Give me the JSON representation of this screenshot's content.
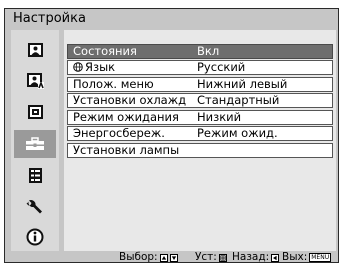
{
  "window": {
    "title": "Настройка"
  },
  "sidebar": {
    "items": [
      {
        "icon": "picture-icon"
      },
      {
        "icon": "picture-settings-icon"
      },
      {
        "icon": "screen-icon"
      },
      {
        "icon": "settings-toolbox-icon",
        "selected": true
      },
      {
        "icon": "menu-list-icon"
      },
      {
        "icon": "wrench-icon"
      },
      {
        "icon": "info-icon"
      }
    ]
  },
  "menu": {
    "rows": [
      {
        "label": "Состояния",
        "value": "Вкл",
        "selected": true
      },
      {
        "label": "Язык",
        "value": "Русский",
        "icon": "globe-icon"
      },
      {
        "label": "Полож. меню",
        "value": "Нижний левый"
      },
      {
        "label": "Установки охлажд",
        "value": "Стандартный"
      },
      {
        "label": "Режим ожидания",
        "value": "Низкий"
      },
      {
        "label": "Энергосбереж.",
        "value": "Режим ожид."
      },
      {
        "label": "Установки лампы",
        "value": ""
      }
    ]
  },
  "footer": {
    "select_label": "Выбор:",
    "set_label": "Уст:",
    "back_label": "Назад:",
    "exit_label": "Вых:",
    "menu_key": "MENU"
  },
  "colors": {
    "frame_bg": "#c6c6c6",
    "selected_row_bg": "#6e6e6e",
    "selected_side_bg": "#9a9a9a"
  }
}
